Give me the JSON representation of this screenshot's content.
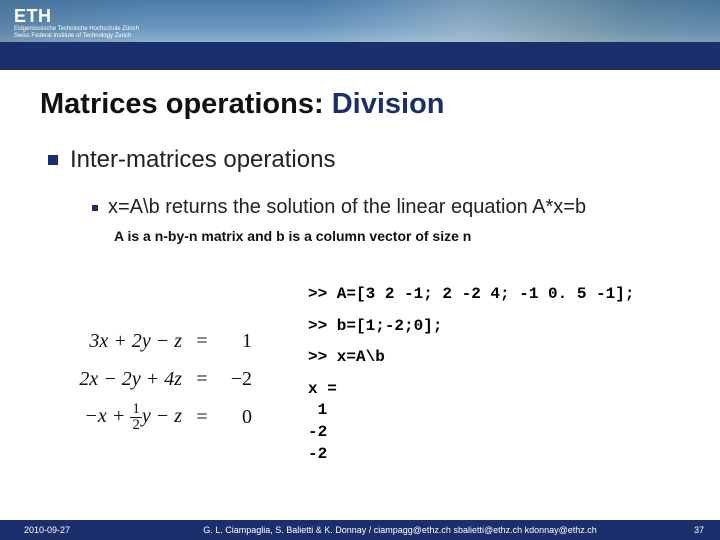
{
  "brand": {
    "logo": "ETH",
    "subtitle1": "Eidgenössische Technische Hochschule Zürich",
    "subtitle2": "Swiss Federal Institute of Technology Zurich"
  },
  "title": {
    "main": "Matrices operations:",
    "accent": " Division"
  },
  "bullets": {
    "level1": "Inter-matrices operations",
    "level2": "x=A\\b returns the solution of the linear equation A*x=b",
    "note": "A is a n-by-n matrix and b is a column vector of size n"
  },
  "code": {
    "line1": ">> A=[3 2 -1; 2 -2 4; -1 0. 5 -1];",
    "line2": ">> b=[1;-2;0];",
    "line3": ">> x=A\\b",
    "result": "x =\n 1\n-2\n-2"
  },
  "equations": {
    "row1": {
      "lhs": "3x + 2y − z",
      "eq": "=",
      "rhs": "1"
    },
    "row2": {
      "lhs": "2x − 2y + 4z",
      "eq": "=",
      "rhs": "−2"
    },
    "row3": {
      "prefix": "−x + ",
      "frac_n": "1",
      "frac_d": "2",
      "mid": "y − z",
      "eq": "=",
      "rhs": "0"
    }
  },
  "footer": {
    "date": "2010-09-27",
    "credits": "G. L. Ciampaglia, S. Balietti & K. Donnay / ciampagg@ethz.ch  sbalietti@ethz.ch  kdonnay@ethz.ch",
    "page": "37"
  }
}
